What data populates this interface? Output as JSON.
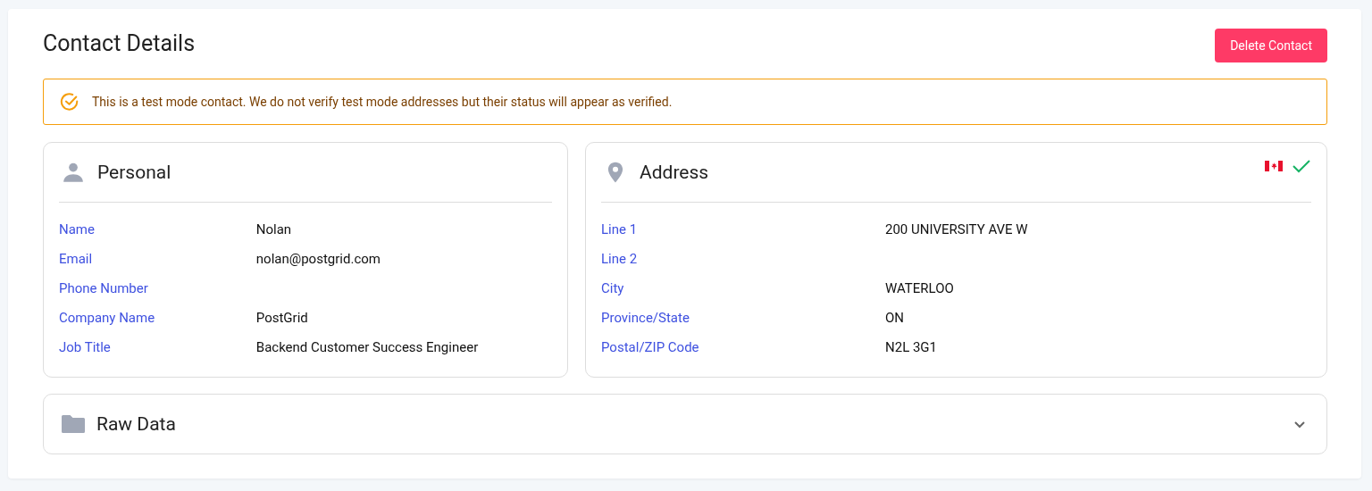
{
  "title": "Contact Details",
  "delete_button": "Delete Contact",
  "notice": "This is a test mode contact. We do not verify test mode addresses but their status will appear as verified.",
  "personal": {
    "title": "Personal",
    "fields": [
      {
        "label": "Name",
        "value": "Nolan"
      },
      {
        "label": "Email",
        "value": "nolan@postgrid.com"
      },
      {
        "label": "Phone Number"
      },
      {
        "label": "Company Name",
        "value": "PostGrid"
      },
      {
        "label": "Job Title",
        "value": "Backend Customer Success Engineer"
      }
    ]
  },
  "address": {
    "title": "Address",
    "verified": true,
    "fields": [
      {
        "label": "Line 1",
        "value": "200 UNIVERSITY AVE W"
      },
      {
        "label": "Line 2"
      },
      {
        "label": "City",
        "value": "WATERLOO"
      },
      {
        "label": "Province/State",
        "value": "ON"
      },
      {
        "label": "Postal/ZIP Code",
        "value": "N2L 3G1"
      }
    ]
  },
  "raw_data": {
    "title": "Raw Data",
    "expanded": false
  }
}
